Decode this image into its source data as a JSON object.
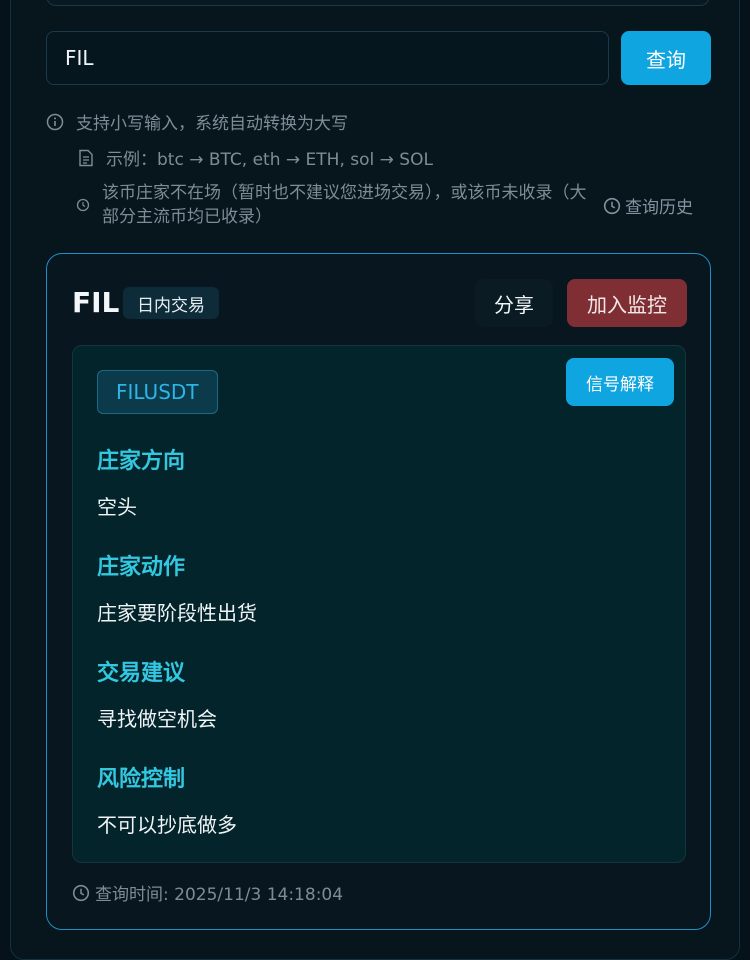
{
  "search": {
    "value": "FIL",
    "button_label": "查询"
  },
  "hints": {
    "lowercase": "支持小写输入，系统自动转换为大写",
    "example": "示例：btc → BTC, eth → ETH, sol → SOL",
    "not_listed": "该币庄家不在场（暂时也不建议您进场交易），或该币未收录（大部分主流币均已收录）",
    "history_link": "查询历史"
  },
  "result": {
    "coin": "FIL",
    "trade_type": "日内交易",
    "share_label": "分享",
    "monitor_label": "加入监控",
    "symbol": "FILUSDT",
    "explain_label": "信号解释",
    "sections": [
      {
        "title": "庄家方向",
        "value": "空头"
      },
      {
        "title": "庄家动作",
        "value": "庄家要阶段性出货"
      },
      {
        "title": "交易建议",
        "value": "寻找做空机会"
      },
      {
        "title": "风险控制",
        "value": "不可以抄底做多"
      }
    ],
    "query_time": "查询时间: 2025/11/3 14:18:04"
  },
  "colors": {
    "accent": "#0ea5e0",
    "danger_button": "#7f2f34",
    "section_title": "#33c7e0",
    "card_border": "#1d8fc4"
  },
  "icons": [
    "info-icon",
    "document-icon",
    "clock-icon"
  ]
}
